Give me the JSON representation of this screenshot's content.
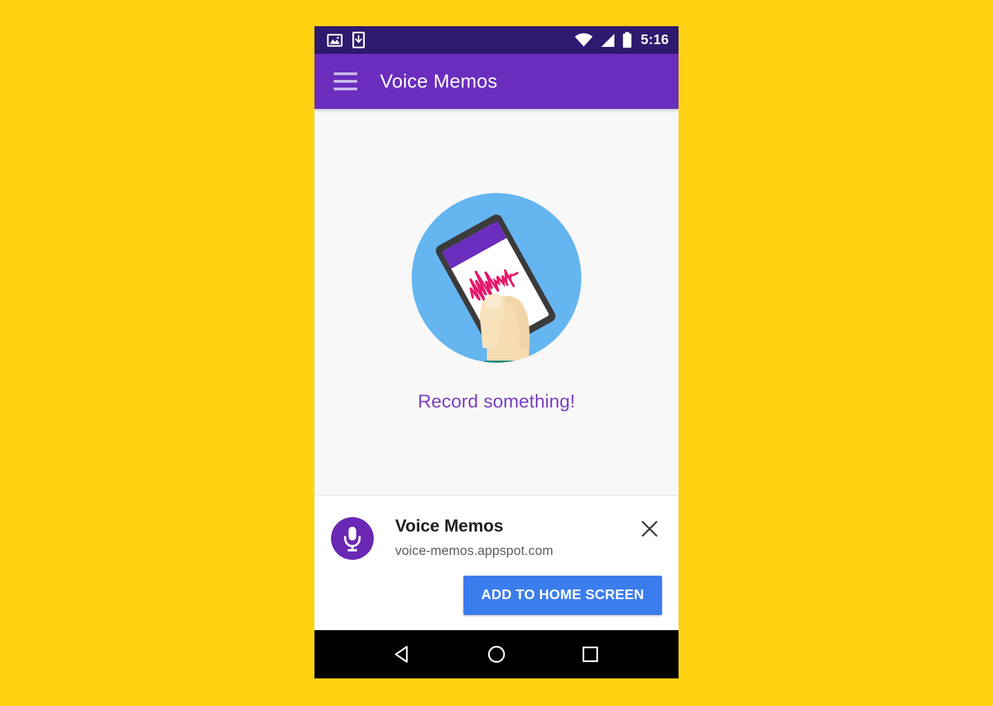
{
  "page": {
    "background_color": "#FFD111"
  },
  "status_bar": {
    "background_color": "#2E1A6E",
    "time": "5:16",
    "left_icons": [
      {
        "name": "image-icon",
        "label": "Screenshot captured"
      },
      {
        "name": "download-icon",
        "label": "Download complete"
      }
    ],
    "right_icons": [
      {
        "name": "wifi-icon",
        "label": "Wi-Fi"
      },
      {
        "name": "cellular-signal-icon",
        "label": "Cellular signal"
      },
      {
        "name": "battery-icon",
        "label": "Battery"
      }
    ]
  },
  "app_bar": {
    "background_color": "#6A2DBD",
    "title": "Voice Memos",
    "menu_icon": "hamburger-menu-icon"
  },
  "content": {
    "background_color": "#F8F8F8",
    "illustration": {
      "name": "hand-holding-phone-illustration",
      "circle_color": "#64B5F0",
      "phone_bezel_color": "#3B3B3B",
      "phone_header_color": "#6A2DBD",
      "phone_screen_color": "#FFFFFF",
      "waveform_color": "#E6176B",
      "skin_color": "#F6DCB0",
      "sleeve_color": "#11897A"
    },
    "empty_message": "Record something!",
    "empty_message_color": "#7B3FBF"
  },
  "install_banner": {
    "background_color": "#FFFFFF",
    "app_icon": {
      "name": "microphone-icon",
      "circle_color": "#6A28B5",
      "glyph_color": "#FFFFFF"
    },
    "app_name": "Voice Memos",
    "origin": "voice-memos.appspot.com",
    "close_icon": "close-icon",
    "install_button_label": "ADD TO HOME SCREEN",
    "install_button_color": "#3B7DED"
  },
  "nav_bar": {
    "background_color": "#000000",
    "buttons": [
      {
        "name": "back-button",
        "icon": "triangle-left-icon"
      },
      {
        "name": "home-button",
        "icon": "circle-icon"
      },
      {
        "name": "recents-button",
        "icon": "square-icon"
      }
    ]
  }
}
